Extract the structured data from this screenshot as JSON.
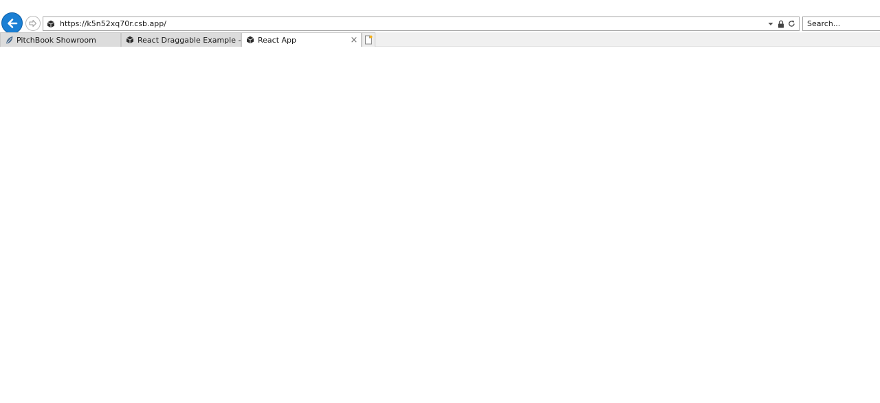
{
  "navigation": {
    "back_icon": "arrow-left-icon",
    "forward_icon": "arrow-right-icon"
  },
  "address_bar": {
    "site_icon": "codesandbox-cube-icon",
    "url": "https://k5n52xq70r.csb.app/",
    "dropdown_icon": "caret-down-icon",
    "lock_icon": "padlock-icon",
    "refresh_icon": "refresh-icon"
  },
  "search": {
    "placeholder": "Search..."
  },
  "tabs": [
    {
      "title": "PitchBook Showroom",
      "icon": "pitchbook-leaf-icon",
      "active": false
    },
    {
      "title": "React Draggable Example - Bo...",
      "icon": "codesandbox-cube-icon",
      "active": false
    },
    {
      "title": "React App",
      "icon": "codesandbox-cube-icon",
      "active": true,
      "close_label": "×"
    }
  ],
  "new_tab_icon": "new-tab-icon",
  "colors": {
    "accent": "#1a7fd4",
    "tab_active": "#ffffff",
    "tab_inactive": "#dcdcdc"
  }
}
